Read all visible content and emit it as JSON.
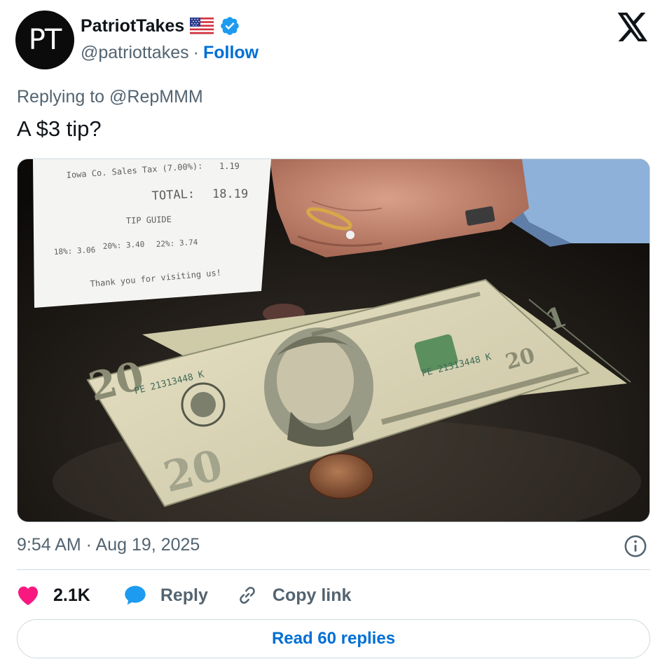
{
  "author": {
    "avatar_text": "PT",
    "name": "PatriotTakes",
    "handle": "@patriottakes",
    "separator": "·",
    "follow_label": "Follow"
  },
  "tweet": {
    "replying_to": "Replying to @RepMMM",
    "text": "A $3 tip?",
    "timestamp": "9:54 AM · Aug 19, 2025"
  },
  "receipt": {
    "tax_line": "Iowa Co. Sales Tax (7.00%):",
    "tax_value": "1.19",
    "total_label": "TOTAL:",
    "total_value": "18.19",
    "tip_guide": "TIP GUIDE",
    "tip_18": "18%: 3.06",
    "tip_20": "20%: 3.40",
    "tip_22": "22%: 3.74",
    "thanks": "Thank you for visiting us!"
  },
  "bill_text": {
    "serial": "PE 21313448 K",
    "denomination": "20"
  },
  "actions": {
    "likes_count": "2.1K",
    "reply_label": "Reply",
    "copy_link_label": "Copy link",
    "read_replies_label": "Read 60 replies"
  },
  "colors": {
    "accent": "#006fd6",
    "like": "#f91880",
    "reply_bubble": "#1d9bf0",
    "muted": "#536471",
    "verified": "#1d9bf0"
  },
  "icons": {
    "flag": "us-flag-icon",
    "verified": "verified-badge-icon",
    "brand": "x-logo-icon",
    "info": "info-icon",
    "like": "heart-icon",
    "reply": "speech-bubble-icon",
    "copy": "link-icon"
  }
}
